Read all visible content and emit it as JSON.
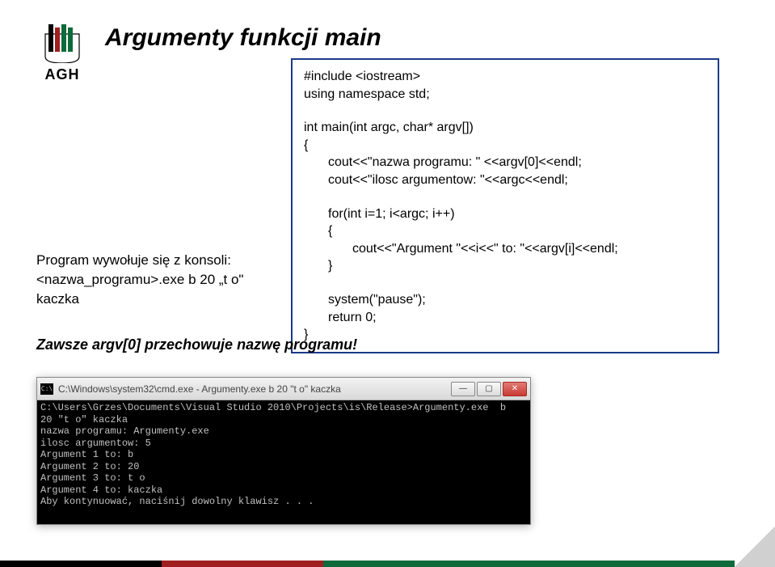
{
  "logo": {
    "text": "AGH"
  },
  "title": "Argumenty funkcji main",
  "code": {
    "l1": "#include <iostream>",
    "l2": "using namespace std;",
    "l3": "int main(int argc, char* argv[])",
    "l4": "{",
    "l5": "cout<<\"nazwa programu: \" <<argv[0]<<endl;",
    "l6": "cout<<\"ilosc argumentow: \"<<argc<<endl;",
    "l7": "for(int i=1; i<argc; i++)",
    "l8": "{",
    "l9": "cout<<\"Argument \"<<i<<\" to: \"<<argv[i]<<endl;",
    "l10": "}",
    "l11": "system(\"pause\");",
    "l12": "return 0;",
    "l13": "}"
  },
  "caption": {
    "line1": "Program wywołuje się z konsoli:",
    "line2": "<nazwa_programu>.exe b 20 „t o\" kaczka"
  },
  "note": "Zawsze argv[0] przechowuje nazwę programu!",
  "console": {
    "title": "C:\\Windows\\system32\\cmd.exe - Argumenty.exe  b 20 \"t o\" kaczka",
    "body": "C:\\Users\\Grzes\\Documents\\Visual Studio 2010\\Projects\\is\\Release>Argumenty.exe  b\n20 \"t o\" kaczka\nnazwa programu: Argumenty.exe\nilosc argumentow: 5\nArgument 1 to: b\nArgument 2 to: 20\nArgument 3 to: t o\nArgument 4 to: kaczka\nAby kontynuować, naciśnij dowolny klawisz . . ."
  },
  "win_buttons": {
    "min": "—",
    "max": "▢",
    "close": "✕"
  }
}
